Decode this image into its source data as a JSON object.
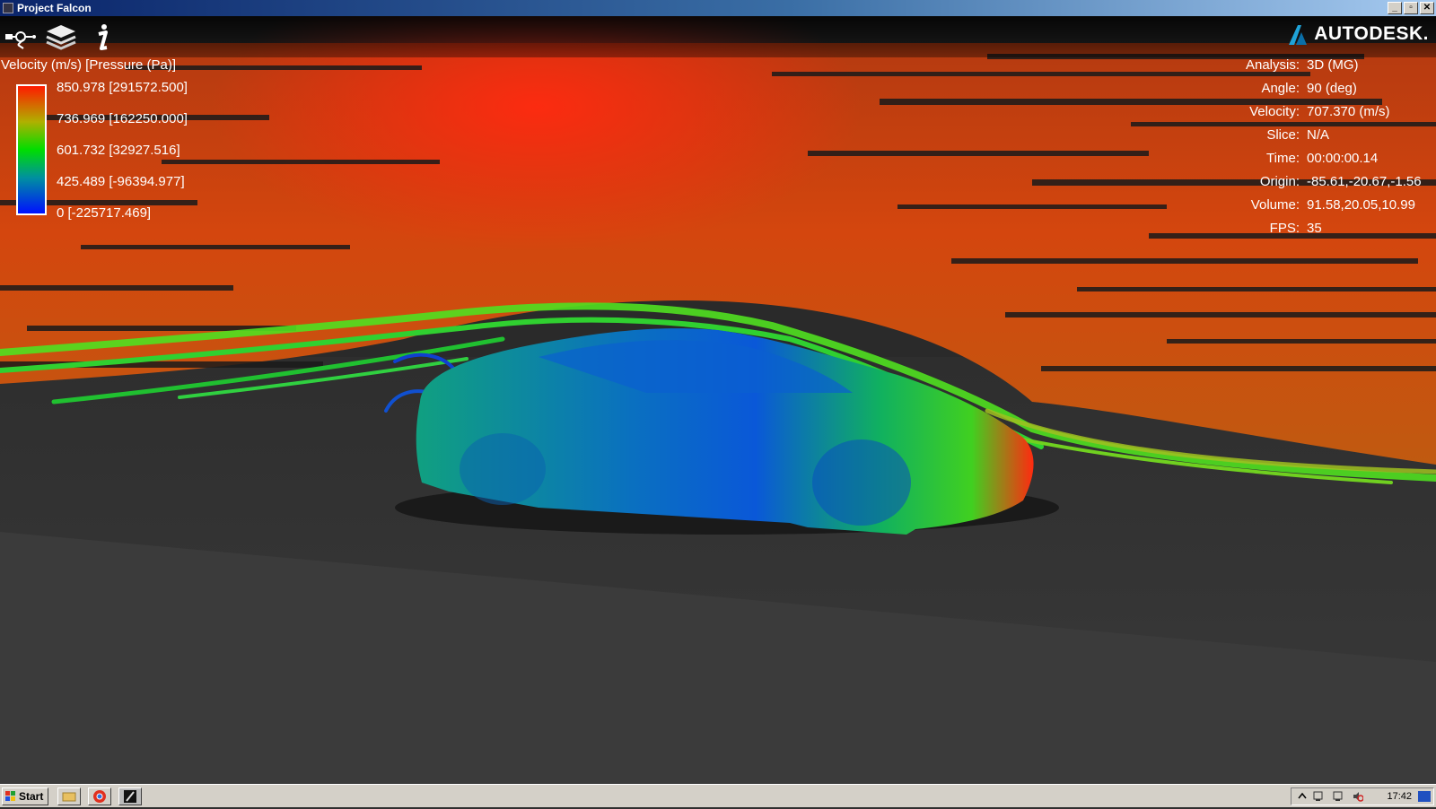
{
  "window": {
    "title": "Project Falcon",
    "controls": [
      "minimize-icon",
      "restore-icon",
      "close-icon"
    ]
  },
  "toolbar": {
    "tools": [
      {
        "name": "settings-sliders-icon"
      },
      {
        "name": "layers-icon"
      },
      {
        "name": "info-icon"
      }
    ],
    "brand": "AUTODESK."
  },
  "legend": {
    "title": "Velocity (m/s) [Pressure (Pa)]",
    "labels": [
      "850.978 [291572.500]",
      "736.969 [162250.000]",
      "601.732 [32927.516]",
      "425.489 [-96394.977]",
      "0 [-225717.469]"
    ],
    "colors": [
      "#ff1a00",
      "#b0b000",
      "#00dd00",
      "#0090a0",
      "#0010ff"
    ]
  },
  "info": [
    {
      "key": "Analysis:",
      "value": "3D (MG)"
    },
    {
      "key": "Angle:",
      "value": "90 (deg)"
    },
    {
      "key": "Velocity:",
      "value": "707.370 (m/s)"
    },
    {
      "key": "Slice:",
      "value": "N/A"
    },
    {
      "key": "Time:",
      "value": "00:00:00.14"
    },
    {
      "key": "Origin:",
      "value": "-85.61,-20.67,-1.56"
    },
    {
      "key": "Volume:",
      "value": "91.58,20.05,10.99"
    },
    {
      "key": "FPS:",
      "value": "35"
    }
  ],
  "taskbar": {
    "start_label": "Start",
    "quick_launch": [
      "folder-icon",
      "chrome-icon",
      "falcon-app-icon"
    ],
    "tray_icons": [
      "chevron-up-icon",
      "network-icon",
      "network-icon-2",
      "volume-muted-icon"
    ],
    "clock": "17:42"
  },
  "colors": {
    "flow_high": "#e82a10",
    "flow_mid": "#d06a10",
    "flow_low": "#20d020",
    "ground": "#353535"
  }
}
